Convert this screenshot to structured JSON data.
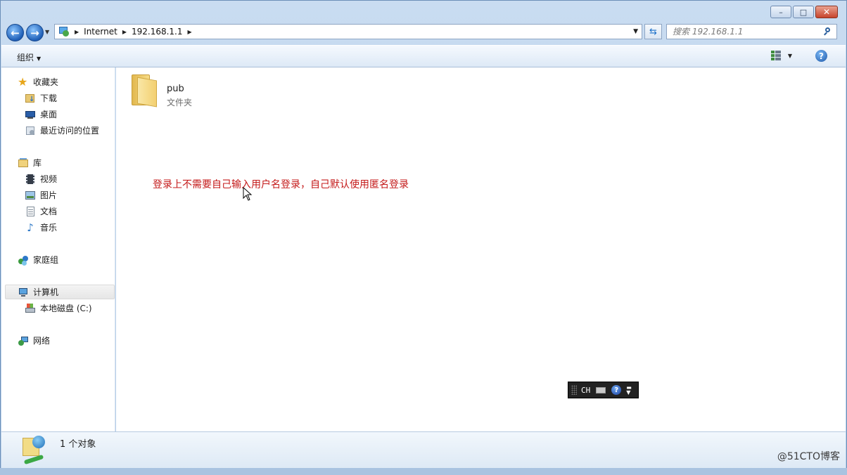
{
  "window": {
    "caption_buttons": {
      "minimize": "–",
      "maximize": "□",
      "close": "✕"
    }
  },
  "address_bar": {
    "breadcrumbs": [
      "Internet",
      "192.168.1.1"
    ]
  },
  "search": {
    "placeholder": "搜索 192.168.1.1"
  },
  "toolbar": {
    "organize_label": "组织"
  },
  "nav": {
    "favorites": {
      "label": "收藏夹",
      "items": [
        "下载",
        "桌面",
        "最近访问的位置"
      ]
    },
    "libraries": {
      "label": "库",
      "items": [
        "视频",
        "图片",
        "文档",
        "音乐"
      ]
    },
    "homegroup": {
      "label": "家庭组"
    },
    "computer": {
      "label": "计算机",
      "items": [
        "本地磁盘 (C:)"
      ]
    },
    "network": {
      "label": "网络"
    }
  },
  "content": {
    "items": [
      {
        "name": "pub",
        "type": "文件夹"
      }
    ],
    "annotation": "登录上不需要自己输入用户名登录，自己默认使用匿名登录"
  },
  "ime_bar": {
    "language": "CH"
  },
  "status": {
    "item_count": "1 个对象"
  },
  "watermark": "@51CTO博客",
  "colors": {
    "annotation": "#c41a1a",
    "accent": "#1f5fb7"
  },
  "icons": [
    "star-icon",
    "download-folder-icon",
    "desktop-icon",
    "recent-places-icon",
    "library-icon",
    "video-icon",
    "pictures-icon",
    "documents-icon",
    "music-icon",
    "homegroup-icon",
    "computer-icon",
    "local-disk-icon",
    "network-icon",
    "folder-icon",
    "search-icon",
    "help-icon"
  ]
}
